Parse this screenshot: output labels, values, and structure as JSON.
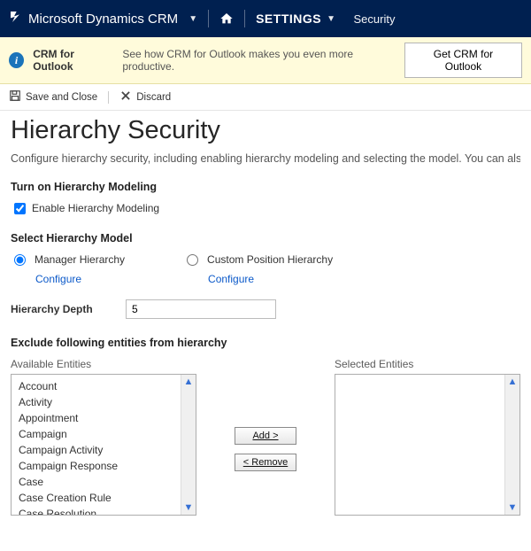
{
  "topnav": {
    "brand": "Microsoft Dynamics CRM",
    "section": "SETTINGS",
    "crumb": "Security"
  },
  "infobar": {
    "title": "CRM for Outlook",
    "text": "See how CRM for Outlook makes you even more productive.",
    "button": "Get CRM for Outlook"
  },
  "toolbar": {
    "save_close": "Save and Close",
    "discard": "Discard"
  },
  "page": {
    "title": "Hierarchy Security",
    "description": "Configure hierarchy security, including enabling hierarchy modeling and selecting the model. You can also specify how deep the hierarchy should be."
  },
  "modeling": {
    "heading": "Turn on Hierarchy Modeling",
    "checkbox_label": "Enable Hierarchy Modeling",
    "checked": true
  },
  "model_select": {
    "heading": "Select Hierarchy Model",
    "option_manager": "Manager Hierarchy",
    "option_custom": "Custom Position Hierarchy",
    "configure": "Configure",
    "selected": "manager"
  },
  "depth": {
    "label": "Hierarchy Depth",
    "value": "5"
  },
  "exclude": {
    "heading": "Exclude following entities from hierarchy",
    "available_label": "Available Entities",
    "selected_label": "Selected Entities",
    "add_label": "Add >",
    "remove_label": "< Remove",
    "available": [
      "Account",
      "Activity",
      "Appointment",
      "Campaign",
      "Campaign Activity",
      "Campaign Response",
      "Case",
      "Case Creation Rule",
      "Case Resolution"
    ],
    "selected": []
  }
}
